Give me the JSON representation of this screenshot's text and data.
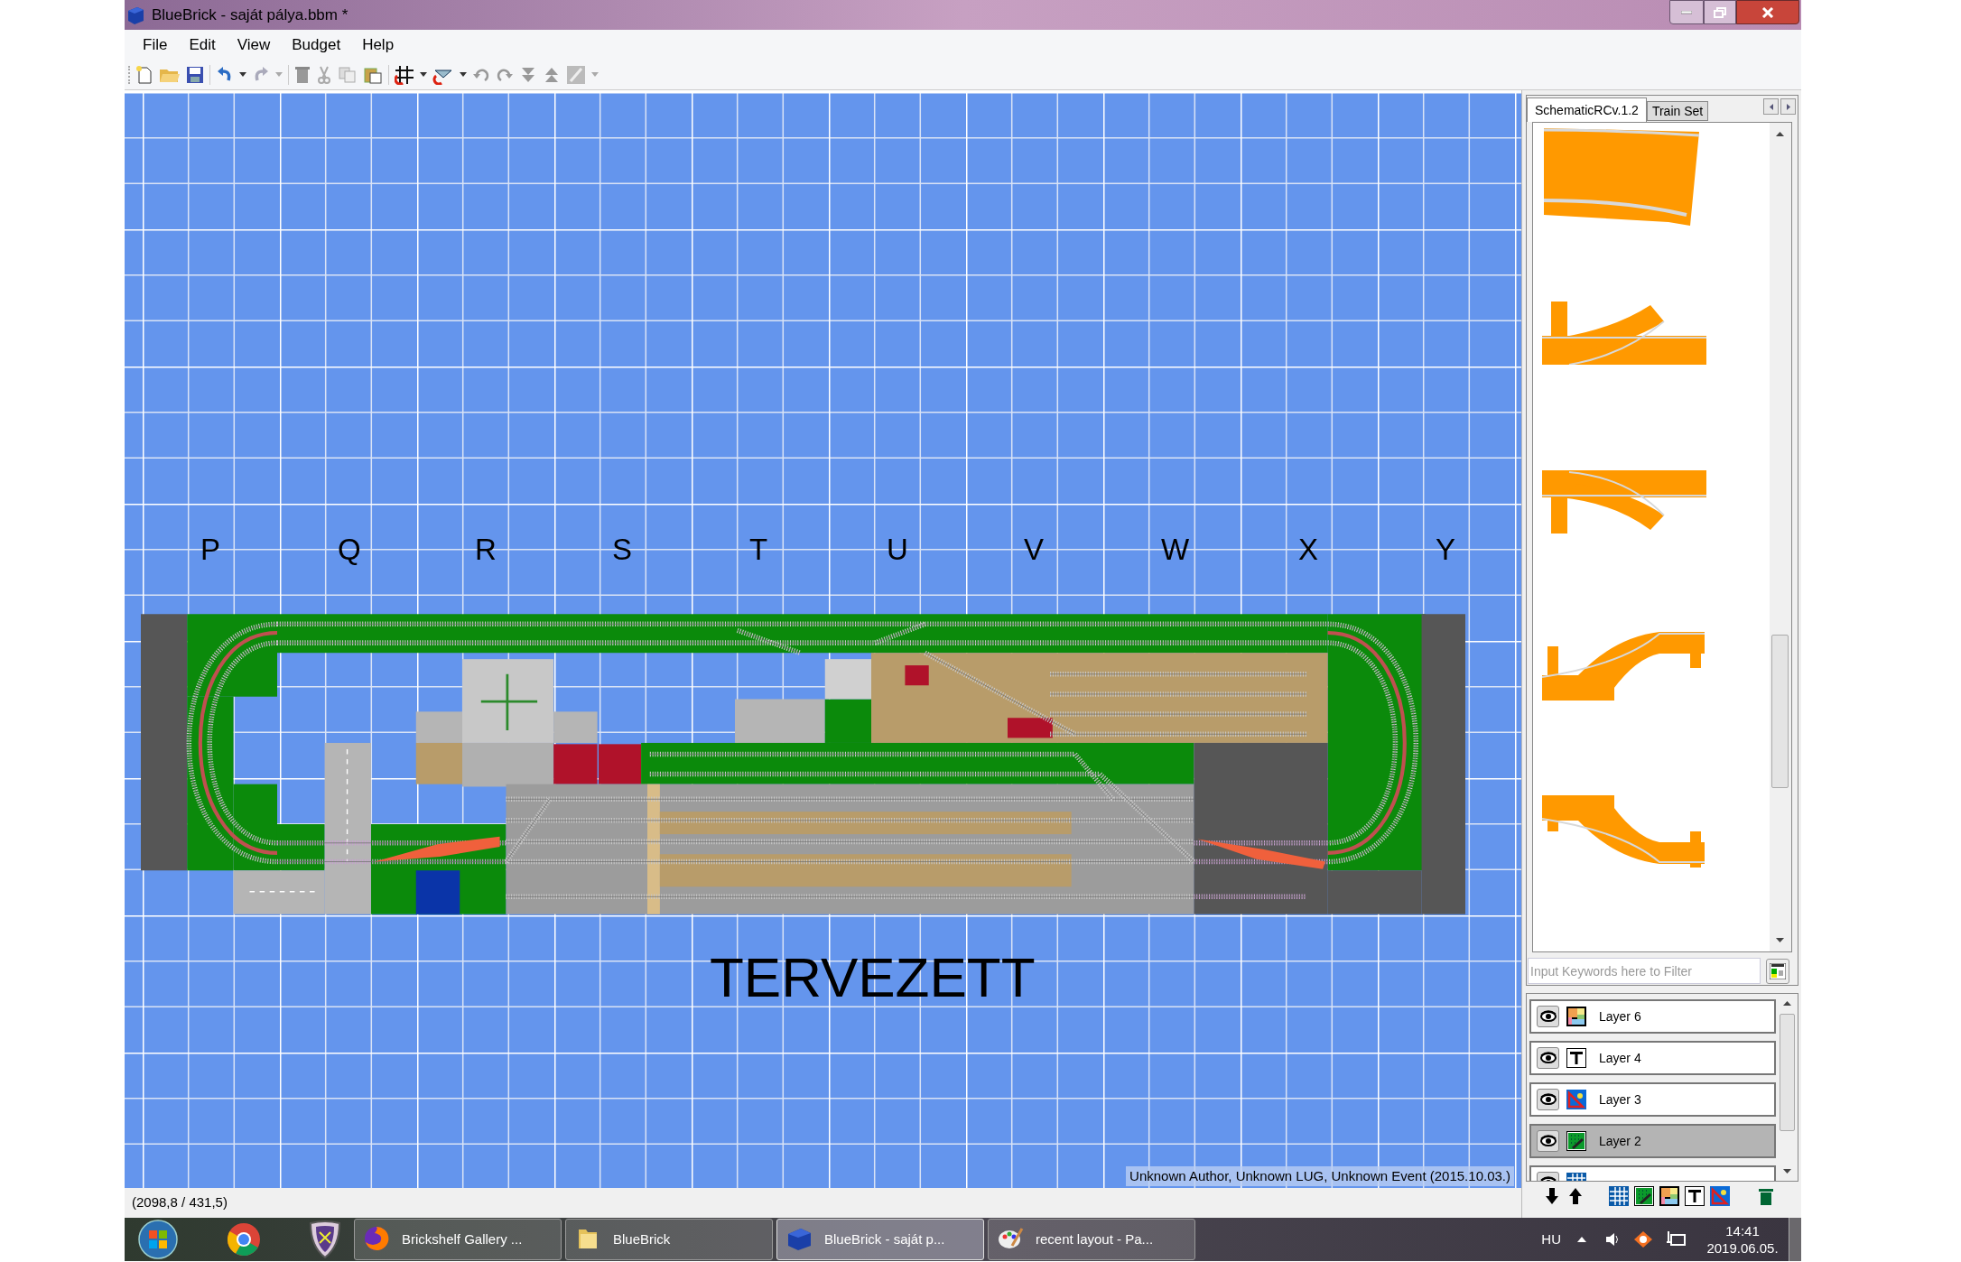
{
  "window": {
    "title": "BlueBrick - saját pálya.bbm *"
  },
  "menu": [
    "File",
    "Edit",
    "View",
    "Budget",
    "Help"
  ],
  "canvas": {
    "column_labels": [
      "P",
      "Q",
      "R",
      "S",
      "T",
      "U",
      "V",
      "W",
      "X",
      "Y"
    ],
    "map_text": "TERVEZETT",
    "info": "Unknown Author, Unknown LUG, Unknown Event (2015.10.03.)"
  },
  "status_bar": {
    "coordinates": "(2098,8 / 431,5)"
  },
  "parts_panel": {
    "tabs": [
      {
        "label": "SchematicRCv.1.2",
        "selected": true
      },
      {
        "label": "Train Set",
        "selected": false
      }
    ],
    "filter": {
      "placeholder": "Input Keywords here to Filter"
    }
  },
  "layers": [
    {
      "name": "Layer 6",
      "kind": "area",
      "visible": true,
      "selected": false
    },
    {
      "name": "Layer 4",
      "kind": "text",
      "visible": true,
      "selected": false
    },
    {
      "name": "Layer 3",
      "kind": "ruler",
      "visible": true,
      "selected": false
    },
    {
      "name": "Layer 2",
      "kind": "brick",
      "visible": true,
      "selected": true
    },
    {
      "kind": "grid",
      "visible": true,
      "selected": false
    }
  ],
  "taskbar": {
    "tasks": [
      {
        "label": "Brickshelf Gallery ...",
        "kind": "firefox",
        "selected": false
      },
      {
        "label": "BlueBrick",
        "kind": "folder",
        "selected": false
      },
      {
        "label": "BlueBrick - saját p...",
        "kind": "bluebrick",
        "selected": true
      },
      {
        "label": "recent layout - Pa...",
        "kind": "paint",
        "selected": false
      }
    ],
    "language": "HU",
    "time": "14:41",
    "date": "2019.06.05."
  }
}
